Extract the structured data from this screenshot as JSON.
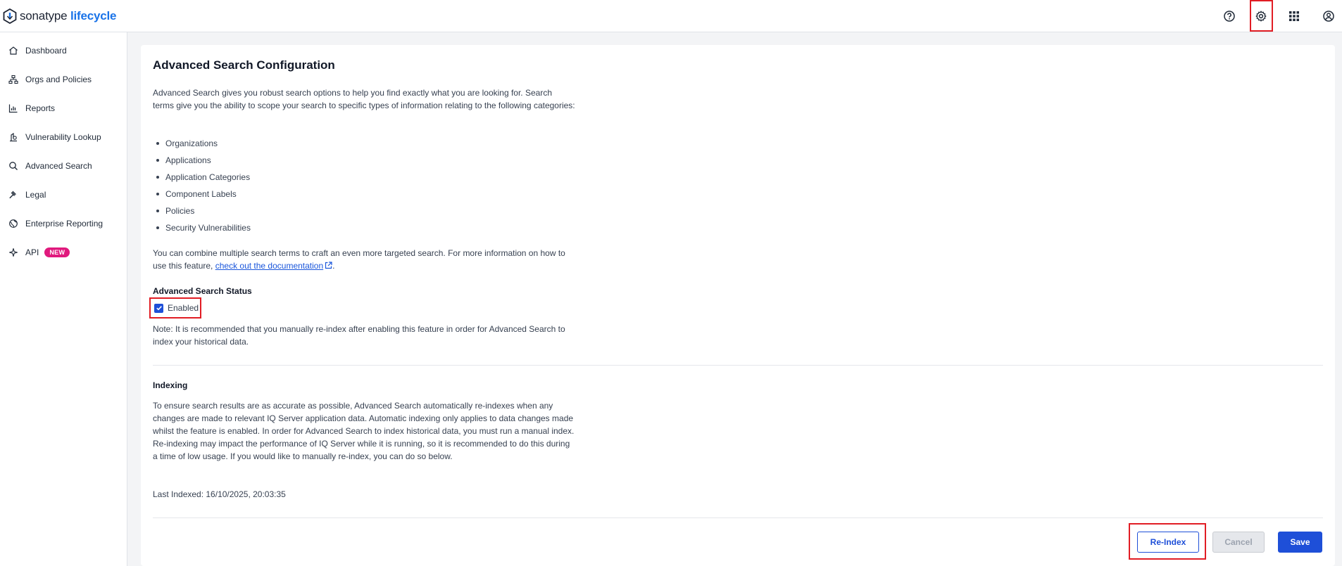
{
  "header": {
    "brand": "sonatype",
    "product": "lifecycle",
    "icons": [
      "help-icon",
      "settings-icon",
      "apps-grid-icon",
      "user-icon"
    ]
  },
  "sidebar": {
    "items": [
      {
        "label": "Dashboard",
        "icon": "home-icon"
      },
      {
        "label": "Orgs and Policies",
        "icon": "org-tree-icon"
      },
      {
        "label": "Reports",
        "icon": "chart-icon"
      },
      {
        "label": "Vulnerability Lookup",
        "icon": "vuln-search-icon"
      },
      {
        "label": "Advanced Search",
        "icon": "search-icon"
      },
      {
        "label": "Legal",
        "icon": "gavel-icon"
      },
      {
        "label": "Enterprise Reporting",
        "icon": "globe-chart-icon"
      },
      {
        "label": "API",
        "icon": "sparkle-icon",
        "badge": "NEW"
      }
    ]
  },
  "main": {
    "title": "Advanced Search Configuration",
    "intro": "Advanced Search gives you robust search options to help you find exactly what you are looking for. Search terms give you the ability to scope your search to specific types of information relating to the following categories:",
    "categories": [
      "Organizations",
      "Applications",
      "Application Categories",
      "Component Labels",
      "Policies",
      "Security Vulnerabilities"
    ],
    "combine_text_before": "You can combine multiple search terms to craft an even more targeted search. For more information on how to use this feature, ",
    "combine_link": "check out the documentation",
    "combine_text_after": ".",
    "status_heading": "Advanced Search Status",
    "enabled_label": "Enabled",
    "enabled_checked": true,
    "note": "Note: It is recommended that you manually re-index after enabling this feature in order for Advanced Search to index your historical data.",
    "indexing_heading": "Indexing",
    "indexing_text": "To ensure search results are as accurate as possible, Advanced Search automatically re-indexes when any changes are made to relevant IQ Server application data. Automatic indexing only applies to data changes made whilst the feature is enabled. In order for Advanced Search to index historical data, you must run a manual index. Re-indexing may impact the performance of IQ Server while it is running, so it is recommended to do this during a time of low usage. If you would like to manually re-index, you can do so below.",
    "last_indexed": "Last Indexed: 16/10/2025, 20:03:35"
  },
  "actions": {
    "reindex": "Re-Index",
    "cancel": "Cancel",
    "save": "Save"
  },
  "colors": {
    "accent": "#1e4fd8",
    "highlight": "#e11d24",
    "badge": "#e0197d"
  }
}
